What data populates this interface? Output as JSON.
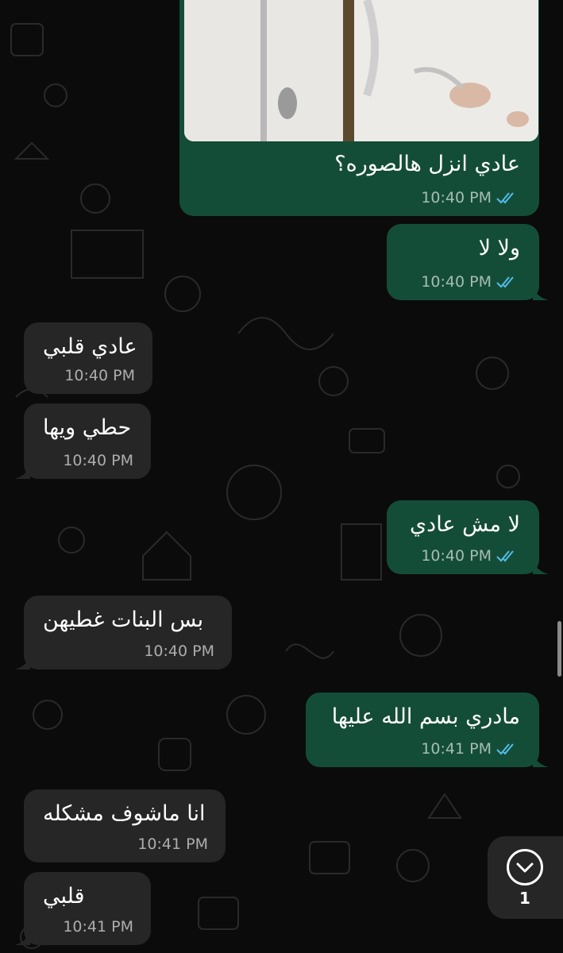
{
  "colors": {
    "background": "#0b0b0b",
    "outgoing_bubble": "#144d37",
    "incoming_bubble": "#262626",
    "read_ticks": "#53bdeb"
  },
  "messages": [
    {
      "direction": "outgoing",
      "has_photo": true,
      "text": "عادي انزل هالصوره؟",
      "time": "10:40 PM",
      "status": "read"
    },
    {
      "direction": "outgoing",
      "text": "ولا لا",
      "time": "10:40 PM",
      "status": "read"
    },
    {
      "direction": "incoming",
      "text": "عادي قلبي",
      "time": "10:40 PM"
    },
    {
      "direction": "incoming",
      "text": "حطي ويها",
      "time": "10:40 PM"
    },
    {
      "direction": "outgoing",
      "text": "لا مش عادي",
      "time": "10:40 PM",
      "status": "read"
    },
    {
      "direction": "incoming",
      "text": "بس البنات غطيهن",
      "time": "10:40 PM"
    },
    {
      "direction": "outgoing",
      "text": "مادري بسم الله عليها",
      "time": "10:41 PM",
      "status": "read"
    },
    {
      "direction": "incoming",
      "text": "انا ماشوف مشكله",
      "time": "10:41 PM"
    },
    {
      "direction": "incoming",
      "text": "قلبي",
      "time": "10:41 PM"
    }
  ],
  "scroll_to_bottom": {
    "icon": "chevron-down-icon",
    "unread_count": "1"
  }
}
